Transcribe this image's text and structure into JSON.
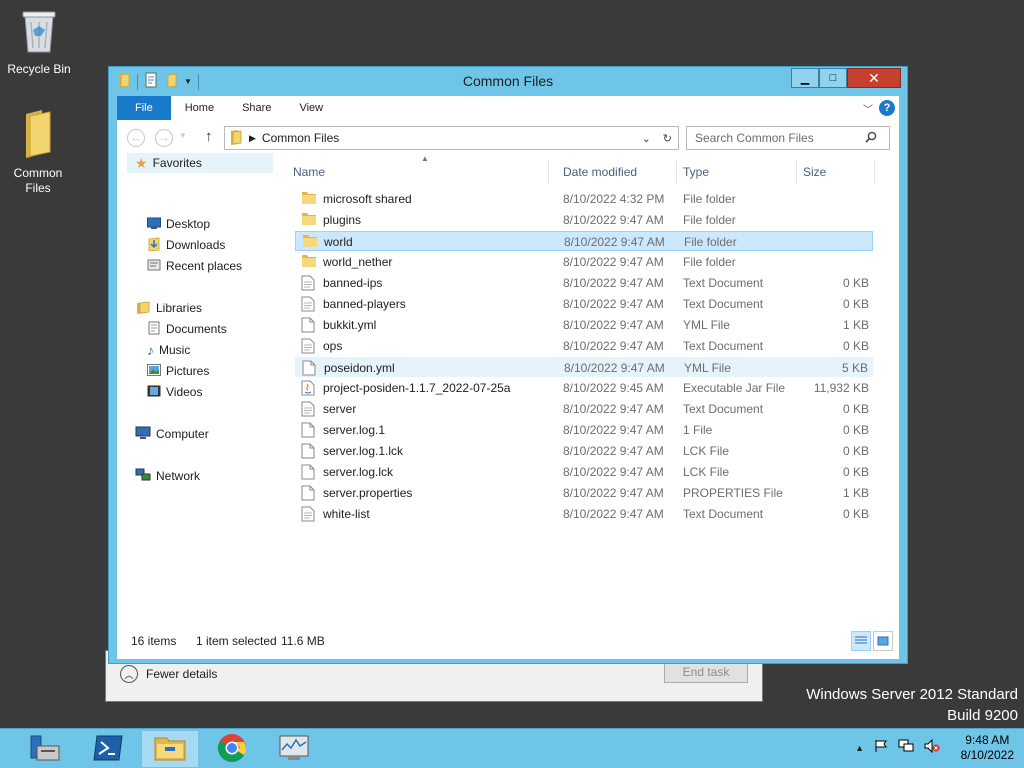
{
  "desktop": {
    "icons": [
      {
        "label": "Recycle Bin",
        "icon": "recycle-bin-icon"
      },
      {
        "label": "Common Files",
        "icon": "folder-icon"
      }
    ],
    "watermark": {
      "line1": "Windows Server 2012 Standard",
      "line2": "Build 9200"
    }
  },
  "background_window": {
    "fewer_details": "Fewer details",
    "end_task": "End task"
  },
  "explorer": {
    "title": "Common Files",
    "window_buttons": {
      "minimize": "minimize-icon",
      "maximize": "maximize-icon",
      "close": "close-icon"
    },
    "ribbon_tabs": [
      "File",
      "Home",
      "Share",
      "View"
    ],
    "address": {
      "path": "Common Files",
      "search_placeholder": "Search Common Files"
    },
    "nav": {
      "favorites": "Favorites",
      "favorites_items": [
        "Desktop",
        "Downloads",
        "Recent places"
      ],
      "libraries": "Libraries",
      "libraries_items": [
        "Documents",
        "Music",
        "Pictures",
        "Videos"
      ],
      "computer": "Computer",
      "network": "Network"
    },
    "columns": {
      "name": "Name",
      "date": "Date modified",
      "type": "Type",
      "size": "Size"
    },
    "files": [
      {
        "name": "microsoft shared",
        "date": "8/10/2022 4:32 PM",
        "type": "File folder",
        "size": "",
        "icon": "folder-icon"
      },
      {
        "name": "plugins",
        "date": "8/10/2022 9:47 AM",
        "type": "File folder",
        "size": "",
        "icon": "folder-icon"
      },
      {
        "name": "world",
        "date": "8/10/2022 9:47 AM",
        "type": "File folder",
        "size": "",
        "icon": "folder-icon",
        "state": "selected"
      },
      {
        "name": "world_nether",
        "date": "8/10/2022 9:47 AM",
        "type": "File folder",
        "size": "",
        "icon": "folder-icon"
      },
      {
        "name": "banned-ips",
        "date": "8/10/2022 9:47 AM",
        "type": "Text Document",
        "size": "0 KB",
        "icon": "text-file-icon"
      },
      {
        "name": "banned-players",
        "date": "8/10/2022 9:47 AM",
        "type": "Text Document",
        "size": "0 KB",
        "icon": "text-file-icon"
      },
      {
        "name": "bukkit.yml",
        "date": "8/10/2022 9:47 AM",
        "type": "YML File",
        "size": "1 KB",
        "icon": "blank-file-icon"
      },
      {
        "name": "ops",
        "date": "8/10/2022 9:47 AM",
        "type": "Text Document",
        "size": "0 KB",
        "icon": "text-file-icon"
      },
      {
        "name": "poseidon.yml",
        "date": "8/10/2022 9:47 AM",
        "type": "YML File",
        "size": "5 KB",
        "icon": "blank-file-icon",
        "state": "hover"
      },
      {
        "name": "project-posiden-1.1.7_2022-07-25a",
        "date": "8/10/2022 9:45 AM",
        "type": "Executable Jar File",
        "size": "11,932 KB",
        "icon": "java-jar-icon"
      },
      {
        "name": "server",
        "date": "8/10/2022 9:47 AM",
        "type": "Text Document",
        "size": "0 KB",
        "icon": "text-file-icon"
      },
      {
        "name": "server.log.1",
        "date": "8/10/2022 9:47 AM",
        "type": "1 File",
        "size": "0 KB",
        "icon": "blank-file-icon"
      },
      {
        "name": "server.log.1.lck",
        "date": "8/10/2022 9:47 AM",
        "type": "LCK File",
        "size": "0 KB",
        "icon": "blank-file-icon"
      },
      {
        "name": "server.log.lck",
        "date": "8/10/2022 9:47 AM",
        "type": "LCK File",
        "size": "0 KB",
        "icon": "blank-file-icon"
      },
      {
        "name": "server.properties",
        "date": "8/10/2022 9:47 AM",
        "type": "PROPERTIES File",
        "size": "1 KB",
        "icon": "blank-file-icon"
      },
      {
        "name": "white-list",
        "date": "8/10/2022 9:47 AM",
        "type": "Text Document",
        "size": "0 KB",
        "icon": "text-file-icon"
      }
    ],
    "status": {
      "count": "16 items",
      "selected": "1 item selected",
      "size": "11.6 MB"
    }
  },
  "taskbar": {
    "apps": [
      "server-manager-icon",
      "powershell-icon",
      "file-explorer-icon",
      "chrome-icon",
      "task-manager-icon"
    ],
    "active_app": "file-explorer-icon",
    "tray_icons": [
      "show-hidden-icons-icon",
      "action-center-flag-icon",
      "network-icon",
      "speaker-muted-icon"
    ],
    "clock": {
      "time": "9:48 AM",
      "date": "8/10/2022"
    }
  },
  "colors": {
    "accent": "#1979ca",
    "chrome": "#6fc5e7",
    "selection": "#cce8ff",
    "desktop": "#3a3a3a",
    "close": "#c7402e"
  }
}
